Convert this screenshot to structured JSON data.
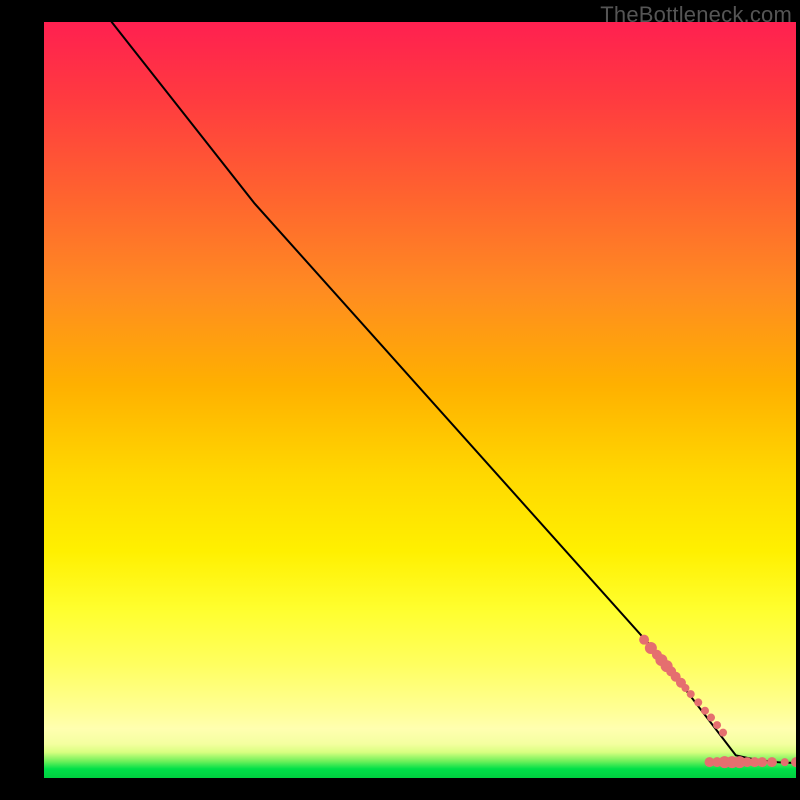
{
  "watermark": "TheBottleneck.com",
  "chart_data": {
    "type": "line",
    "title": "",
    "xlabel": "",
    "ylabel": "",
    "xlim": [
      0,
      100
    ],
    "ylim": [
      0,
      100
    ],
    "background_gradient": {
      "bottom": "#00d040",
      "mid_low": "#ffff30",
      "mid": "#ffb000",
      "top": "#ff2050"
    },
    "curve": [
      {
        "x": 9,
        "y": 100
      },
      {
        "x": 28,
        "y": 76
      },
      {
        "x": 82,
        "y": 16
      },
      {
        "x": 92,
        "y": 3
      },
      {
        "x": 100,
        "y": 2
      }
    ],
    "points": [
      {
        "x": 79.8,
        "y": 18.3,
        "r": 5
      },
      {
        "x": 80.7,
        "y": 17.2,
        "r": 6
      },
      {
        "x": 81.5,
        "y": 16.3,
        "r": 5
      },
      {
        "x": 82.1,
        "y": 15.6,
        "r": 6
      },
      {
        "x": 82.8,
        "y": 14.8,
        "r": 6
      },
      {
        "x": 83.4,
        "y": 14.1,
        "r": 5
      },
      {
        "x": 84.0,
        "y": 13.4,
        "r": 5
      },
      {
        "x": 84.7,
        "y": 12.6,
        "r": 5
      },
      {
        "x": 85.3,
        "y": 11.9,
        "r": 4
      },
      {
        "x": 86.0,
        "y": 11.1,
        "r": 4
      },
      {
        "x": 87.0,
        "y": 10.0,
        "r": 4
      },
      {
        "x": 87.9,
        "y": 8.9,
        "r": 4
      },
      {
        "x": 88.7,
        "y": 8.0,
        "r": 4
      },
      {
        "x": 89.5,
        "y": 7.0,
        "r": 4
      },
      {
        "x": 90.3,
        "y": 6.0,
        "r": 4
      },
      {
        "x": 88.5,
        "y": 2.1,
        "r": 5
      },
      {
        "x": 89.5,
        "y": 2.1,
        "r": 5
      },
      {
        "x": 90.5,
        "y": 2.1,
        "r": 6
      },
      {
        "x": 91.5,
        "y": 2.1,
        "r": 6
      },
      {
        "x": 92.5,
        "y": 2.1,
        "r": 6
      },
      {
        "x": 93.5,
        "y": 2.1,
        "r": 5
      },
      {
        "x": 94.5,
        "y": 2.1,
        "r": 5
      },
      {
        "x": 95.5,
        "y": 2.1,
        "r": 5
      },
      {
        "x": 96.8,
        "y": 2.1,
        "r": 5
      },
      {
        "x": 98.5,
        "y": 2.1,
        "r": 4
      },
      {
        "x": 100.0,
        "y": 2.1,
        "r": 5
      }
    ]
  }
}
